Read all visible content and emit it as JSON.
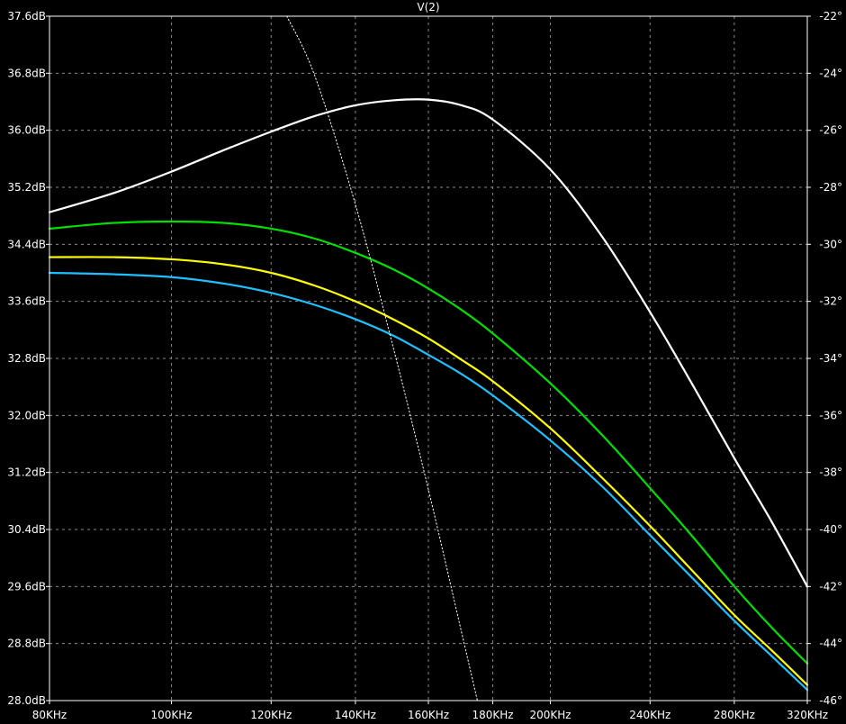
{
  "chart_data": {
    "type": "line",
    "title": "V(2)",
    "x_scale": "log",
    "x_unit": "Hz",
    "xlim": [
      80000,
      320000
    ],
    "ylim_left": [
      28.0,
      37.6
    ],
    "ylim_right": [
      -46,
      -22
    ],
    "grid": true,
    "background": "#000000",
    "x_ticks": [
      {
        "value": 80000,
        "label": "80KHz"
      },
      {
        "value": 100000,
        "label": "100KHz"
      },
      {
        "value": 120000,
        "label": "120KHz"
      },
      {
        "value": 140000,
        "label": "140KHz"
      },
      {
        "value": 160000,
        "label": "160KHz"
      },
      {
        "value": 180000,
        "label": "180KHz"
      },
      {
        "value": 200000,
        "label": "200KHz"
      },
      {
        "value": 240000,
        "label": "240KHz"
      },
      {
        "value": 280000,
        "label": "280KHz"
      },
      {
        "value": 320000,
        "label": "320KHz"
      }
    ],
    "y_left_ticks": [
      {
        "value": 37.6,
        "label": "37.6dB"
      },
      {
        "value": 36.8,
        "label": "36.8dB"
      },
      {
        "value": 36.0,
        "label": "36.0dB"
      },
      {
        "value": 35.2,
        "label": "35.2dB"
      },
      {
        "value": 34.4,
        "label": "34.4dB"
      },
      {
        "value": 33.6,
        "label": "33.6dB"
      },
      {
        "value": 32.8,
        "label": "32.8dB"
      },
      {
        "value": 32.0,
        "label": "32.0dB"
      },
      {
        "value": 31.2,
        "label": "31.2dB"
      },
      {
        "value": 30.4,
        "label": "30.4dB"
      },
      {
        "value": 29.6,
        "label": "29.6dB"
      },
      {
        "value": 28.8,
        "label": "28.8dB"
      },
      {
        "value": 28.0,
        "label": "28.0dB"
      }
    ],
    "y_right_ticks": [
      {
        "value": -22,
        "label": "-22°"
      },
      {
        "value": -24,
        "label": "-24°"
      },
      {
        "value": -26,
        "label": "-26°"
      },
      {
        "value": -28,
        "label": "-28°"
      },
      {
        "value": -30,
        "label": "-30°"
      },
      {
        "value": -32,
        "label": "-32°"
      },
      {
        "value": -34,
        "label": "-34°"
      },
      {
        "value": -36,
        "label": "-36°"
      },
      {
        "value": -38,
        "label": "-38°"
      },
      {
        "value": -40,
        "label": "-40°"
      },
      {
        "value": -42,
        "label": "-42°"
      },
      {
        "value": -44,
        "label": "-44°"
      },
      {
        "value": -46,
        "label": "-46°"
      }
    ],
    "series": [
      {
        "color": "#ffffff",
        "axis": "left",
        "style": "solid",
        "x": [
          80000,
          90000,
          100000,
          110000,
          120000,
          130000,
          140000,
          150000,
          160000,
          170000,
          180000,
          200000,
          220000,
          240000,
          260000,
          280000,
          300000,
          320000
        ],
        "y": [
          34.85,
          35.12,
          35.42,
          35.72,
          35.98,
          36.2,
          36.35,
          36.42,
          36.43,
          36.35,
          36.15,
          35.45,
          34.5,
          33.45,
          32.4,
          31.4,
          30.5,
          29.6
        ]
      },
      {
        "color": "#00e000",
        "axis": "left",
        "style": "solid",
        "x": [
          80000,
          90000,
          100000,
          110000,
          120000,
          130000,
          140000,
          150000,
          160000,
          170000,
          180000,
          200000,
          220000,
          240000,
          260000,
          280000,
          300000,
          320000
        ],
        "y": [
          34.62,
          34.7,
          34.72,
          34.7,
          34.62,
          34.48,
          34.28,
          34.05,
          33.78,
          33.48,
          33.15,
          32.45,
          31.72,
          30.98,
          30.28,
          29.6,
          29.02,
          28.52
        ]
      },
      {
        "color": "#ffff00",
        "axis": "left",
        "style": "solid",
        "x": [
          80000,
          90000,
          100000,
          110000,
          120000,
          130000,
          140000,
          150000,
          160000,
          170000,
          180000,
          200000,
          220000,
          240000,
          260000,
          280000,
          300000,
          320000
        ],
        "y": [
          34.22,
          34.22,
          34.19,
          34.12,
          34.0,
          33.82,
          33.6,
          33.35,
          33.08,
          32.78,
          32.48,
          31.82,
          31.12,
          30.45,
          29.8,
          29.2,
          28.7,
          28.22
        ]
      },
      {
        "color": "#1ec0ff",
        "axis": "left",
        "style": "solid",
        "x": [
          80000,
          90000,
          100000,
          110000,
          120000,
          130000,
          140000,
          150000,
          160000,
          170000,
          180000,
          200000,
          220000,
          240000,
          260000,
          280000,
          300000,
          320000
        ],
        "y": [
          34.0,
          33.98,
          33.94,
          33.85,
          33.72,
          33.55,
          33.35,
          33.12,
          32.85,
          32.58,
          32.28,
          31.65,
          31.0,
          30.32,
          29.7,
          29.12,
          28.62,
          28.15
        ]
      },
      {
        "color": "#ffffff",
        "axis": "right",
        "style": "dotted",
        "x": [
          123500,
          130000,
          140000,
          150000,
          160000,
          170000,
          175000
        ],
        "y": [
          -22.0,
          -24.1,
          -28.6,
          -33.6,
          -38.6,
          -43.6,
          -46.0
        ]
      }
    ]
  }
}
